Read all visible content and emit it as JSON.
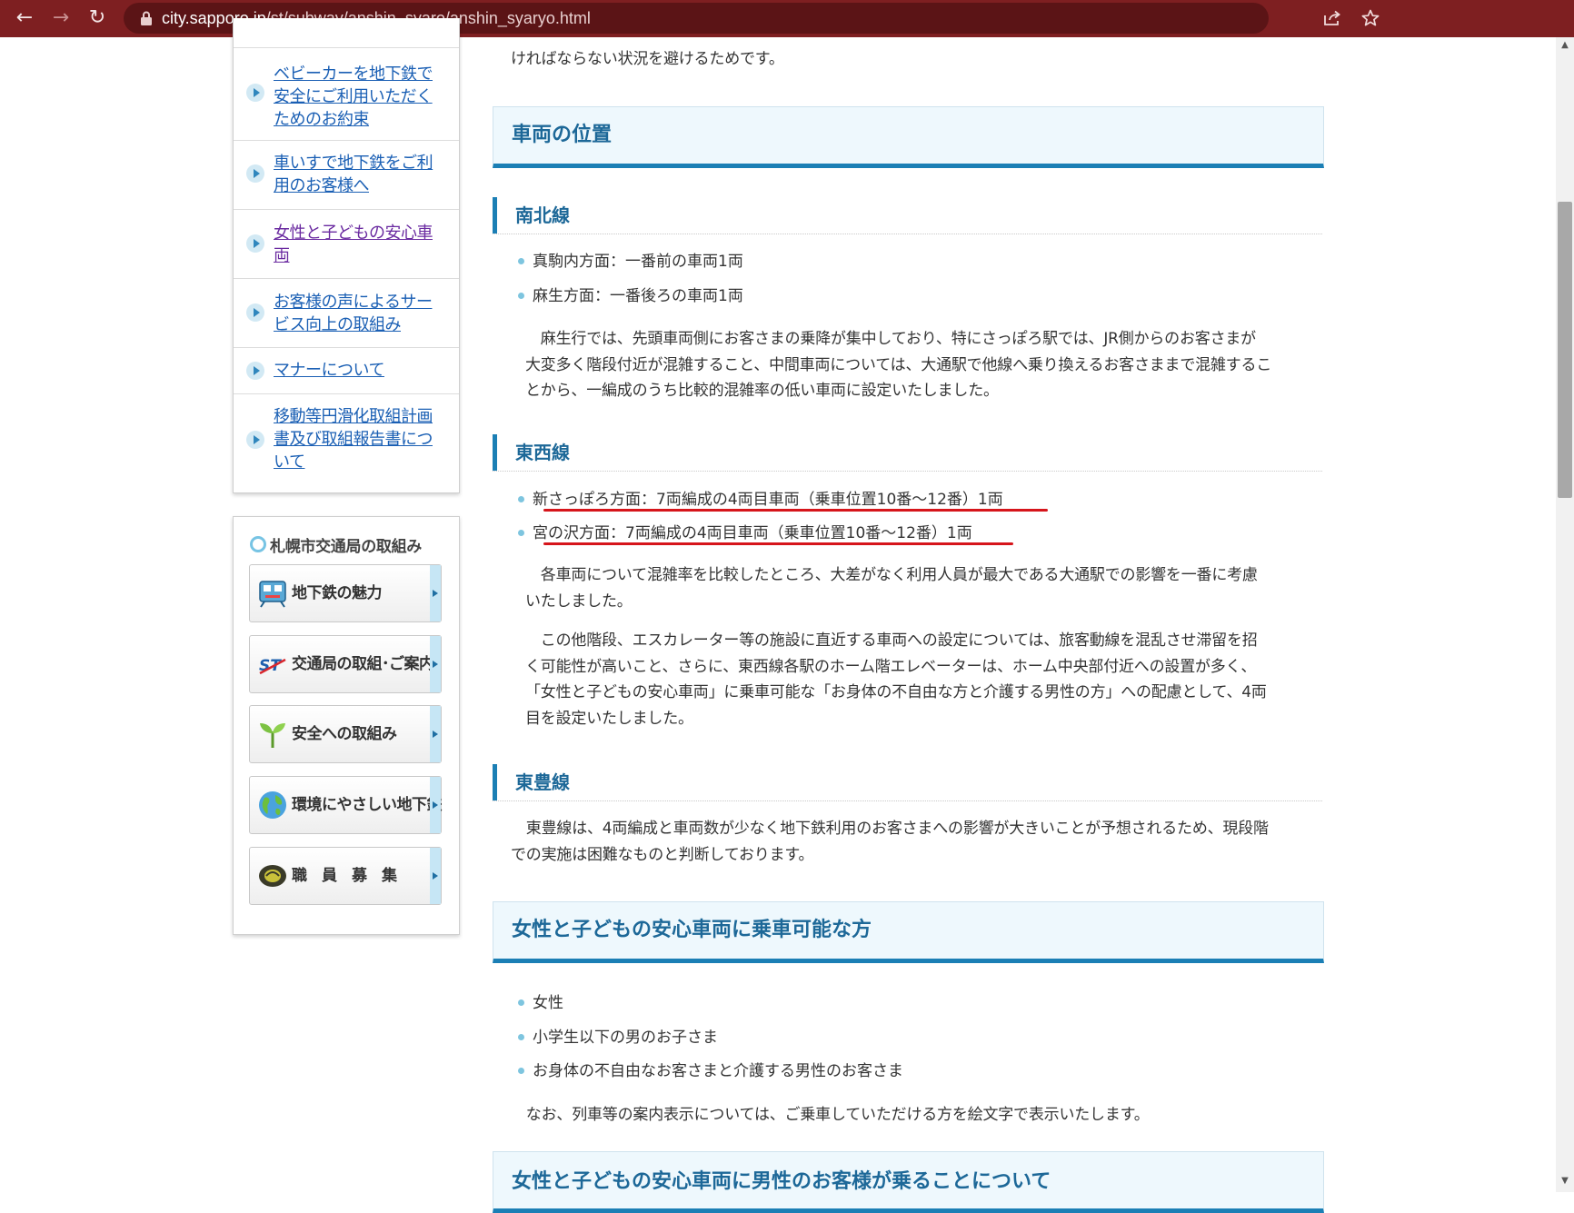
{
  "browser": {
    "url_host": "city.sapporo.jp",
    "url_path": "/st/subway/anshin_syaro/anshin_syaryo.html"
  },
  "sidebar": {
    "nav_items": [
      {
        "label": "ベビーカーを地下鉄で安全にご利用いただくためのお約束"
      },
      {
        "label": "車いすで地下鉄をご利用のお客様へ"
      },
      {
        "label": "女性と子どもの安心車両"
      },
      {
        "label": "お客様の声によるサービス向上の取組み"
      },
      {
        "label": "マナーについて"
      },
      {
        "label": "移動等円滑化取組計画書及び取組報告書について"
      }
    ],
    "torikumi": {
      "title": "札幌市交通局の取組み",
      "tiles": [
        {
          "label": "地下鉄の魅力",
          "icon": "train-icon"
        },
        {
          "label": "交通局の取組･ご案内",
          "icon": "st-logo-icon"
        },
        {
          "label": "安全への取組み",
          "icon": "sprout-icon"
        },
        {
          "label": "環境にやさしい地下鉄",
          "icon": "globe-icon"
        },
        {
          "label": "職　員　募　集",
          "icon": "recruit-icon"
        }
      ]
    }
  },
  "main": {
    "top_line": "ければならない状況を避けるためです。",
    "section_position": {
      "heading": "車両の位置",
      "nanboku": {
        "heading": "南北線",
        "items": [
          "真駒内方面：一番前の車両1両",
          "麻生方面：一番後ろの車両1両"
        ],
        "body_lines": [
          "　麻生行では、先頭車両側にお客さまの乗降が集中しており、特にさっぽろ駅では、JR側からのお客さまが",
          "大変多く階段付近が混雑すること、中間車両については、大通駅で他線へ乗り換えるお客さままで混雑するこ",
          "とから、一編成のうち比較的混雑率の低い車両に設定いたしました。"
        ]
      },
      "tozai": {
        "heading": "東西線",
        "items": [
          "新さっぽろ方面：7両編成の4両目車両（乗車位置10番～12番）1両",
          "宮の沢方面：7両編成の4両目車両（乗車位置10番～12番）1両"
        ],
        "body1_lines": [
          "　各車両について混雑率を比較したところ、大差がなく利用人員が最大である大通駅での影響を一番に考慮",
          "いたしました。"
        ],
        "body2_lines": [
          "　この他階段、エスカレーター等の施設に直近する車両への設定については、旅客動線を混乱させ滞留を招",
          "く可能性が高いこと、さらに、東西線各駅のホーム階エレベーターは、ホーム中央部付近への設置が多く、",
          "「女性と子どもの安心車両」に乗車可能な「お身体の不自由な方と介護する男性の方」への配慮として、4両",
          "目を設定いたしました。"
        ]
      },
      "toho": {
        "heading": "東豊線",
        "body_lines": [
          "　東豊線は、4両編成と車両数が少なく地下鉄利用のお客さまへの影響が大きいことが予想されるため、現段階",
          "での実施は困難なものと判断しております。"
        ]
      }
    },
    "section_eligible": {
      "heading": "女性と子どもの安心車両に乗車可能な方",
      "items": [
        "女性",
        "小学生以下の男のお子さま",
        "お身体の不自由なお客さまと介護する男性のお客さま"
      ],
      "note": "　なお、列車等の案内表示については、ご乗車していただける方を絵文字で表示いたします。"
    },
    "section_men": {
      "heading": "女性と子どもの安心車両に男性のお客様が乗ることについて"
    }
  }
}
